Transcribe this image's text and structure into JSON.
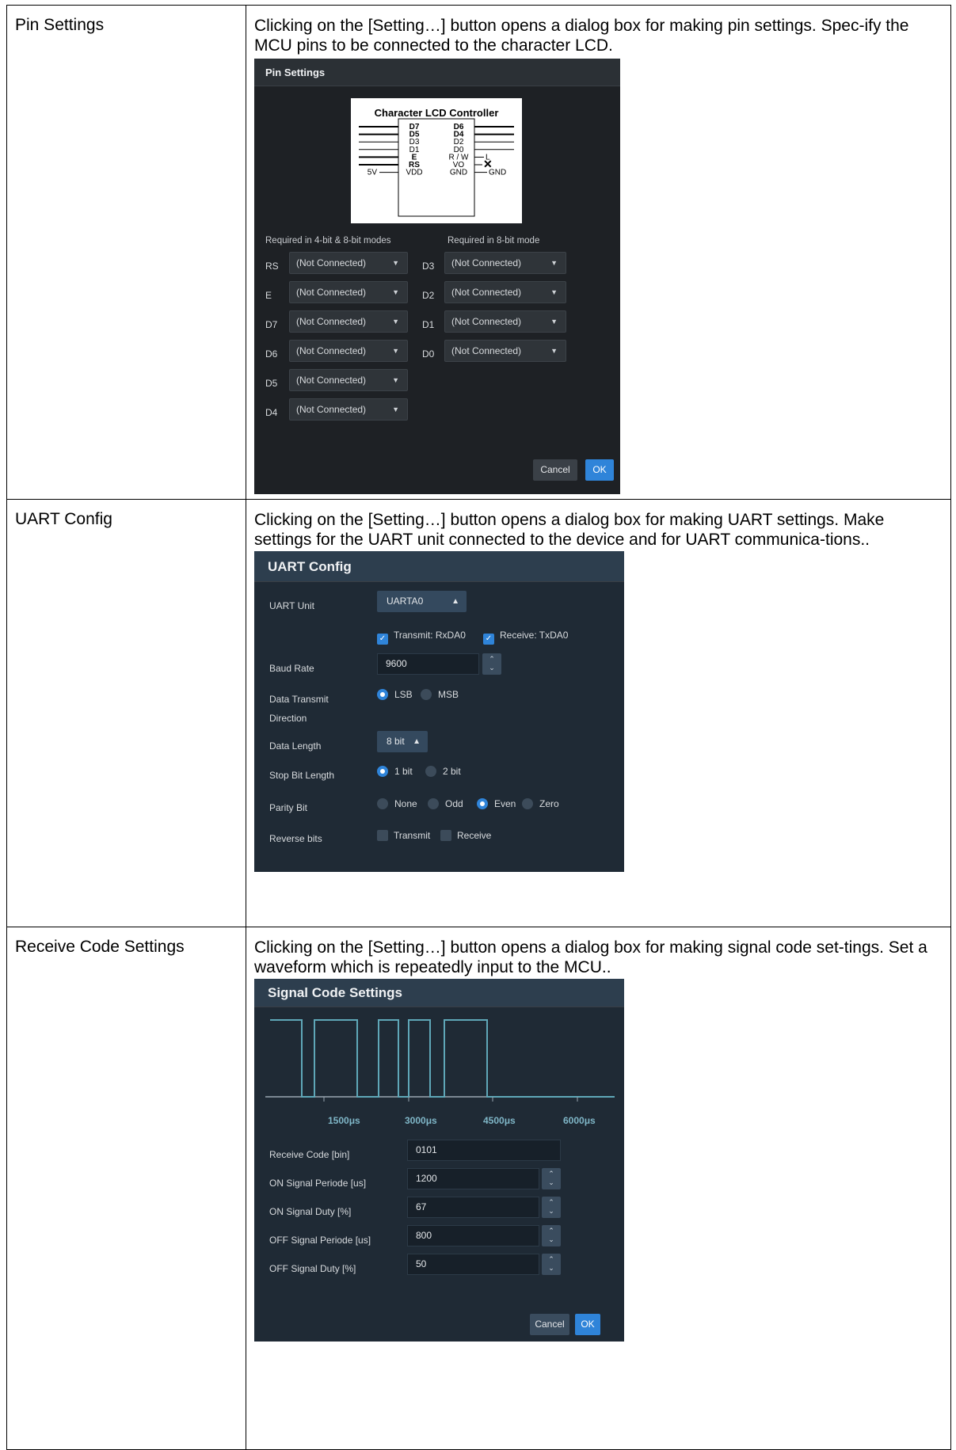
{
  "rows": [
    {
      "label": "Pin Settings",
      "desc": "Clicking on the [Setting…] button opens a dialog box for making pin settings. Spec-ify the MCU pins to be connected to the character LCD."
    },
    {
      "label": "UART Config",
      "desc": "Clicking on the [Setting…] button opens a dialog box for making UART settings. Make settings for the UART unit connected to the device and for UART communica-tions.."
    },
    {
      "label": "Receive Code Settings",
      "desc": "Clicking on the [Setting…] button opens a dialog box for making signal code set-tings. Set a waveform which is repeatedly input to the MCU.."
    }
  ],
  "pin_dialog": {
    "title": "Pin Settings",
    "diagram_title": "Character LCD Controller",
    "diagram_pins_left": [
      "D7",
      "D5",
      "D3",
      "D1",
      "E",
      "RS",
      "VDD"
    ],
    "diagram_pins_right": [
      "D6",
      "D4",
      "D2",
      "D0",
      "R / W",
      "VO",
      "GND"
    ],
    "diagram_ext": {
      "vdd": "5V",
      "rw": "L",
      "gnd": "GND",
      "vo": "✕"
    },
    "left_header": "Required in 4-bit & 8-bit modes",
    "right_header": "Required in 8-bit mode",
    "left_pins": [
      {
        "pin": "RS",
        "value": "(Not Connected)"
      },
      {
        "pin": "E",
        "value": "(Not Connected)"
      },
      {
        "pin": "D7",
        "value": "(Not Connected)"
      },
      {
        "pin": "D6",
        "value": "(Not Connected)"
      },
      {
        "pin": "D5",
        "value": "(Not Connected)"
      },
      {
        "pin": "D4",
        "value": "(Not Connected)"
      }
    ],
    "right_pins": [
      {
        "pin": "D3",
        "value": "(Not Connected)"
      },
      {
        "pin": "D2",
        "value": "(Not Connected)"
      },
      {
        "pin": "D1",
        "value": "(Not Connected)"
      },
      {
        "pin": "D0",
        "value": "(Not Connected)"
      }
    ],
    "cancel": "Cancel",
    "ok": "OK"
  },
  "uart_dialog": {
    "title": "UART Config",
    "unit_label": "UART Unit",
    "unit_value": "UARTA0",
    "transmit_check": {
      "label": "Transmit: RxDA0",
      "checked": true
    },
    "receive_check": {
      "label": "Receive: TxDA0",
      "checked": true
    },
    "baud_label": "Baud Rate",
    "baud_value": "9600",
    "direction_label_1": "Data Transmit",
    "direction_label_2": "Direction",
    "direction_options": [
      "LSB",
      "MSB"
    ],
    "direction_selected": "LSB",
    "length_label": "Data Length",
    "length_value": "8 bit",
    "stop_label": "Stop Bit Length",
    "stop_options": [
      "1 bit",
      "2 bit"
    ],
    "stop_selected": "1 bit",
    "parity_label": "Parity Bit",
    "parity_options": [
      "None",
      "Odd",
      "Even",
      "Zero"
    ],
    "parity_selected": "Even",
    "reverse_label": "Reverse bits",
    "reverse_transmit": {
      "label": "Transmit",
      "checked": false
    },
    "reverse_receive": {
      "label": "Receive",
      "checked": false
    },
    "cancel": "Cancel",
    "ok": "OK"
  },
  "signal_dialog": {
    "title": "Signal Code Settings",
    "ticks": [
      "1500μs",
      "3000μs",
      "4500μs",
      "6000μs"
    ],
    "fields": [
      {
        "label": "Receive Code [bin]",
        "value": "0101",
        "spinner": false
      },
      {
        "label": "ON Signal Periode [us]",
        "value": "1200",
        "spinner": true
      },
      {
        "label": "ON Signal Duty [%]",
        "value": "67",
        "spinner": true
      },
      {
        "label": "OFF Signal Periode [us]",
        "value": "800",
        "spinner": true
      },
      {
        "label": "OFF Signal Duty [%]",
        "value": "50",
        "spinner": true
      }
    ],
    "cancel": "Cancel",
    "ok": "OK"
  },
  "colors": {
    "accent": "#2f84d9",
    "waveform": "#5fa7b8"
  }
}
